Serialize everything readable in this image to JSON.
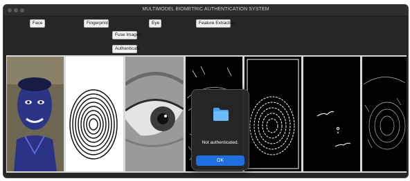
{
  "window": {
    "title": "MULTIMODEL BIOMETRIC AUTHENTICATION SYSTEM"
  },
  "toolbar": {
    "face_label": "Face",
    "fingerprint_label": "Fingerprint",
    "eye_label": "Eye",
    "feature_extraction_label": "Feature Extraction",
    "fuse_images_label": "Fuse Images",
    "authenticate_label": "Authenticate"
  },
  "images": [
    "face-photo",
    "fingerprint-image",
    "eye-image",
    "eye-edge-map",
    "fingerprint-edge-map",
    "feature-points-map",
    "fused-edge-map"
  ],
  "dialog": {
    "icon": "folder-icon",
    "message": "Not authenticated.",
    "ok_label": "OK"
  },
  "colors": {
    "dialog_button": "#1f6fe0",
    "window_bg": "#262626"
  }
}
